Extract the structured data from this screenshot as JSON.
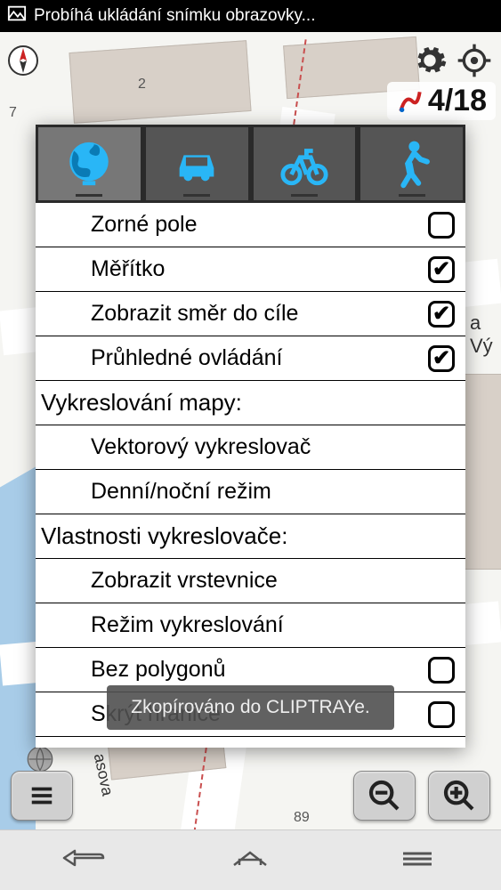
{
  "status_bar": {
    "title": "Probíhá ukládání snímku obrazovky..."
  },
  "counter": {
    "text": "4/18"
  },
  "map_labels": {
    "n7": "7",
    "n2": "2",
    "n89": "89"
  },
  "tabs": {
    "globe": "globe",
    "car": "car",
    "bike": "bike",
    "walk": "walk"
  },
  "rows": [
    {
      "label": "Zorné pole",
      "type": "check",
      "checked": false,
      "indent": true
    },
    {
      "label": "Měřítko",
      "type": "check",
      "checked": true,
      "indent": true
    },
    {
      "label": "Zobrazit směr do cíle",
      "type": "check",
      "checked": true,
      "indent": true
    },
    {
      "label": "Průhledné ovládání",
      "type": "check",
      "checked": true,
      "indent": true
    },
    {
      "label": "Vykreslování mapy:",
      "type": "section"
    },
    {
      "label": "Vektorový vykreslovač",
      "type": "item",
      "indent": true
    },
    {
      "label": "Denní/noční režim",
      "type": "item",
      "indent": true
    },
    {
      "label": "Vlastnosti vykreslovače:",
      "type": "section"
    },
    {
      "label": "Zobrazit vrstevnice",
      "type": "item",
      "indent": true
    },
    {
      "label": "Režim vykreslování",
      "type": "item",
      "indent": true
    },
    {
      "label": "Bez polygonů",
      "type": "check",
      "checked": false,
      "indent": true
    },
    {
      "label": "Skrýt hranice",
      "type": "check",
      "checked": false,
      "indent": true
    }
  ],
  "toast": {
    "text": "Zkopírováno do CLIPTRAYe."
  },
  "bg_text": {
    "street": "a Vý",
    "street2": "asova"
  }
}
